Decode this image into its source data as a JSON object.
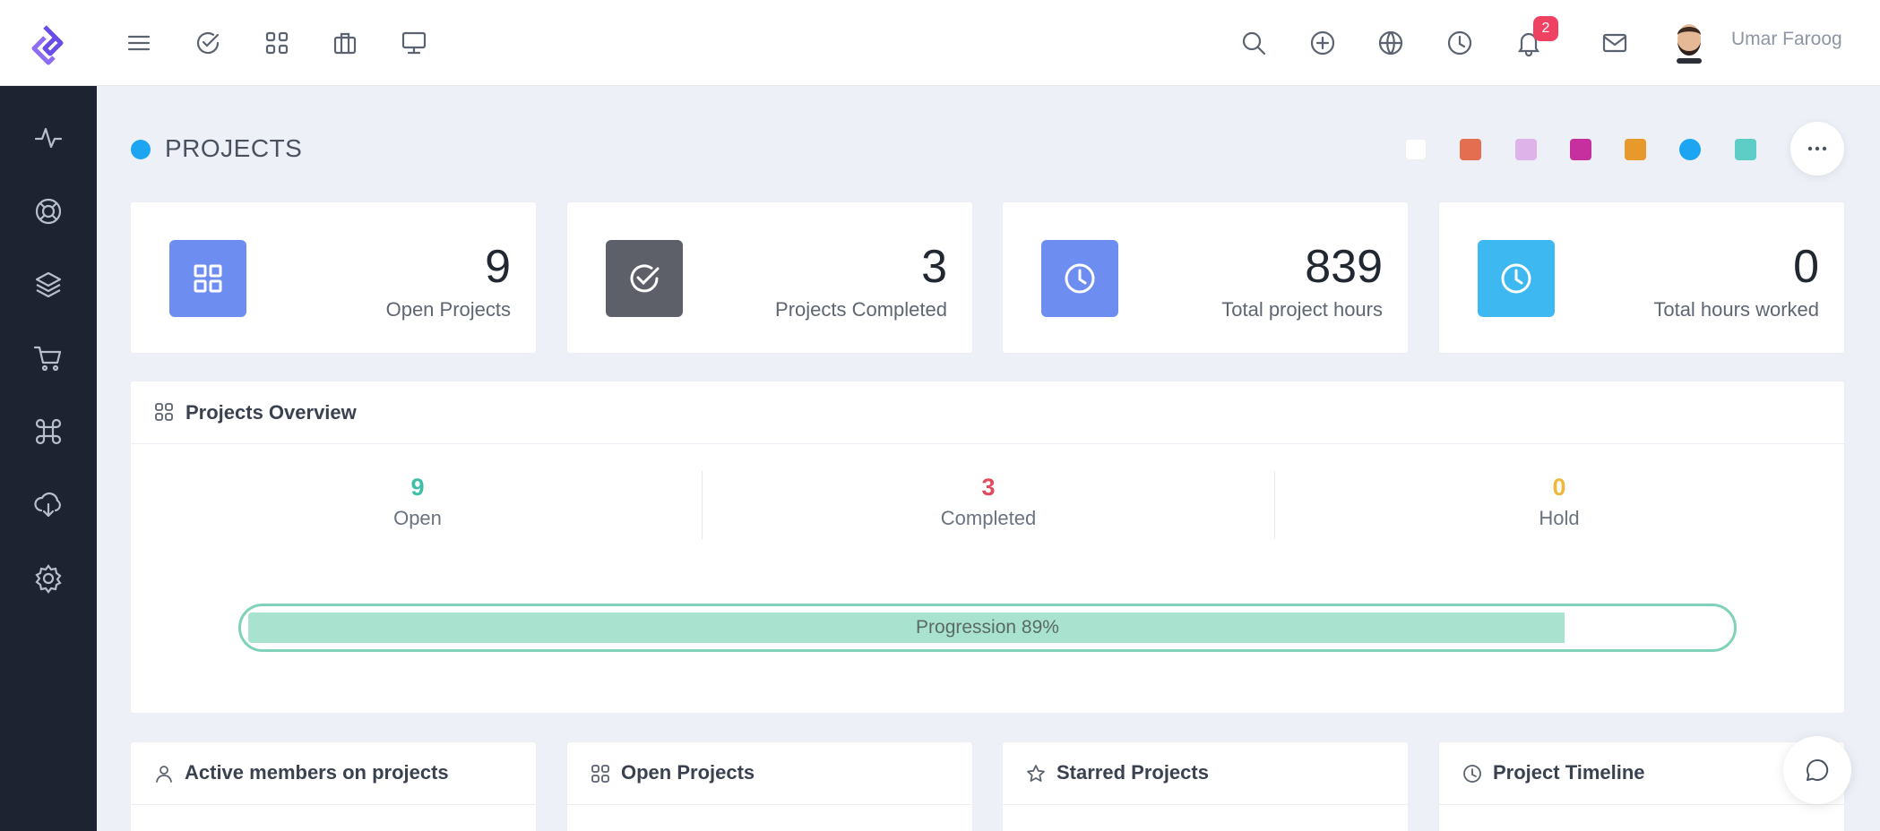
{
  "header": {
    "user_name": "Umar Faroog",
    "notification_count": "2",
    "left_icons": [
      "menu-icon",
      "check-circle-icon",
      "grid-icon",
      "briefcase-icon",
      "monitor-icon"
    ],
    "right_icons": [
      "search-icon",
      "plus-circle-icon",
      "globe-icon",
      "clock-icon",
      "bell-icon",
      "mail-icon"
    ]
  },
  "sidebar": {
    "icons": [
      "activity-icon",
      "lifebuoy-icon",
      "layers-icon",
      "cart-icon",
      "command-icon",
      "cloud-download-icon",
      "settings-icon"
    ]
  },
  "page": {
    "title": "PROJECTS",
    "accent": "#1ea5f2",
    "theme_swatches": [
      "#ffffff",
      "#e36e50",
      "#ddb3ea",
      "#c6309e",
      "#e8992b",
      "#1ea5f2",
      "#5ecdc6"
    ]
  },
  "stats": [
    {
      "value": "9",
      "label": "Open Projects",
      "icon": "grid-icon",
      "color": "#6d8ef0"
    },
    {
      "value": "3",
      "label": "Projects Completed",
      "icon": "check-circle-icon",
      "color": "#5e6069"
    },
    {
      "value": "839",
      "label": "Total project hours",
      "icon": "clock-icon",
      "color": "#6d8ef0"
    },
    {
      "value": "0",
      "label": "Total hours worked",
      "icon": "clock-icon",
      "color": "#3db8f0"
    }
  ],
  "overview": {
    "title": "Projects Overview",
    "columns": [
      {
        "value": "9",
        "label": "Open",
        "color": "#3dbfa5"
      },
      {
        "value": "3",
        "label": "Completed",
        "color": "#e24a5e"
      },
      {
        "value": "0",
        "label": "Hold",
        "color": "#efb73e"
      }
    ],
    "progress_label": "Progression 89%",
    "progress_value": 0.89
  },
  "panels": [
    {
      "title": "Active members on projects",
      "icon": "user-icon"
    },
    {
      "title": "Open Projects",
      "icon": "grid-icon"
    },
    {
      "title": "Starred Projects",
      "icon": "star-icon"
    },
    {
      "title": "Project Timeline",
      "icon": "clock-icon"
    }
  ]
}
